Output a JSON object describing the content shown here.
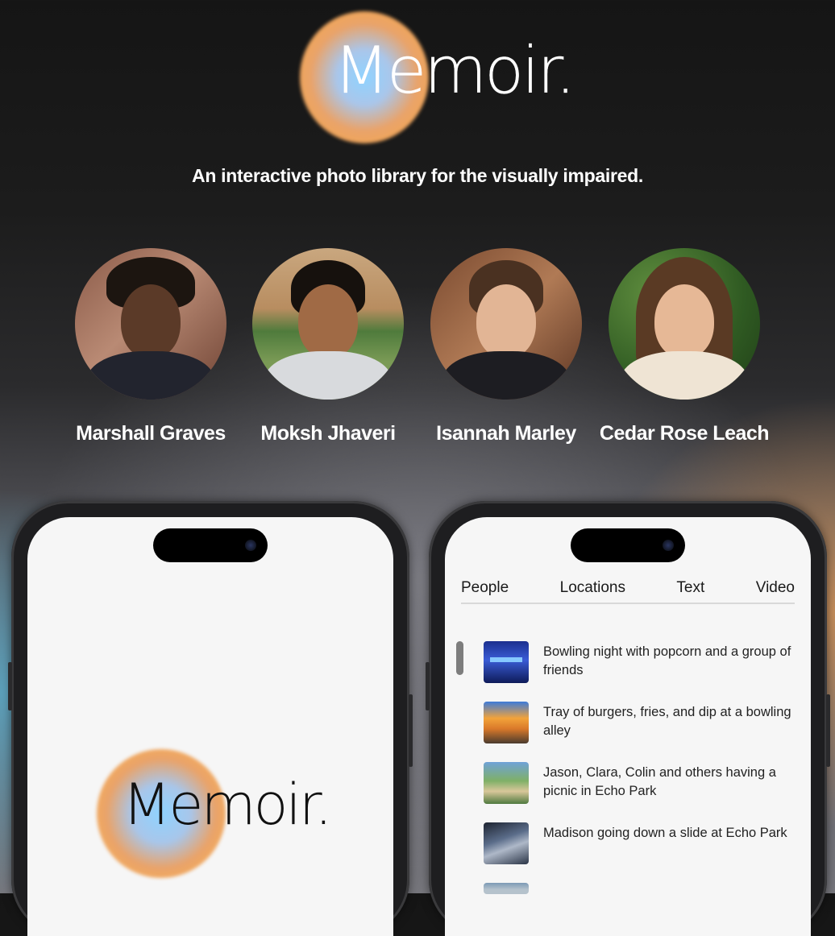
{
  "brand": {
    "name": "Memoir."
  },
  "tagline": "An interactive photo library for the visually impaired.",
  "team": [
    {
      "name": "Marshall Graves"
    },
    {
      "name": "Moksh Jhaveri"
    },
    {
      "name": "Isannah Marley"
    },
    {
      "name": "Cedar Rose Leach"
    }
  ],
  "phone_left": {
    "brand": "Memoir."
  },
  "phone_right": {
    "tabs": [
      "People",
      "Locations",
      "Text",
      "Video"
    ],
    "photos": [
      {
        "caption": "Bowling night with popcorn and a group of friends"
      },
      {
        "caption": "Tray of burgers, fries, and dip at a bowling alley"
      },
      {
        "caption": "Jason, Clara, Colin and others having a picnic in Echo Park"
      },
      {
        "caption": "Madison going down a slide at Echo Park"
      }
    ]
  }
}
